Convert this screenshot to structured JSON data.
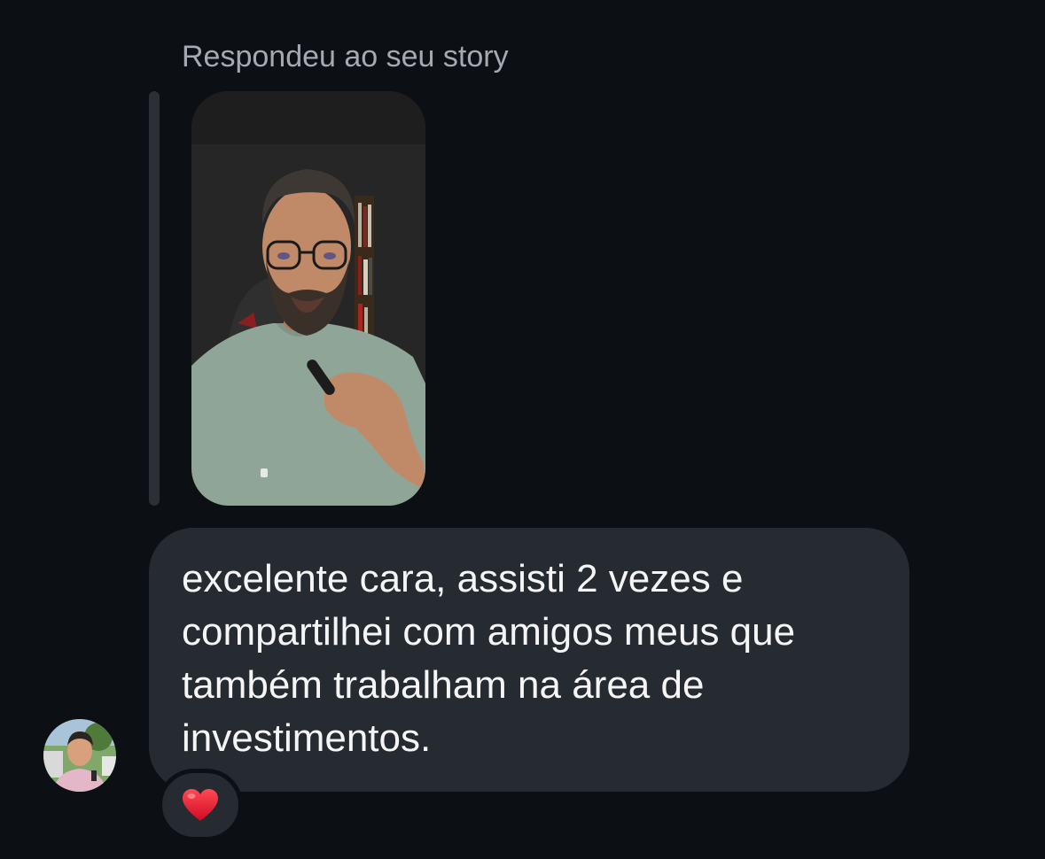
{
  "message": {
    "reply_caption": "Respondeu ao seu story",
    "text": "excelente cara, assisti 2 vezes e\ncompartilhei com amigos meus que\ntambém trabalham na área de\ninvestimentos.",
    "reaction": "❤️"
  },
  "colors": {
    "background": "#0c1014",
    "bubble": "#262a31",
    "caption": "#a8a8b3",
    "reply_bar": "#2c3036",
    "heart": "#e8142c"
  }
}
